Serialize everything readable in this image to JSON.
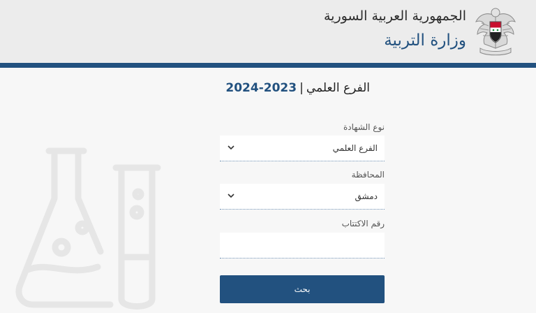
{
  "header": {
    "country": "الجمهورية العربية السورية",
    "ministry": "وزارة التربية",
    "emblem_icon": "syrian-eagle-emblem"
  },
  "form": {
    "title_branch": "الفرع العلمي",
    "title_separator": "|",
    "title_year": "2023-2024",
    "certificate_type": {
      "label": "نوع الشهادة",
      "selected": "الفرع العلمي"
    },
    "governorate": {
      "label": "المحافظة",
      "selected": "دمشق"
    },
    "seat_number": {
      "label": "رقم الاكتتاب",
      "value": "",
      "placeholder": ""
    },
    "search_label": "بحث"
  },
  "decoration": {
    "icon": "lab-flask-test-tube-icon"
  },
  "colors": {
    "accent": "#22517f",
    "header_bg": "#ececec",
    "page_bg": "#f7f7f7"
  }
}
